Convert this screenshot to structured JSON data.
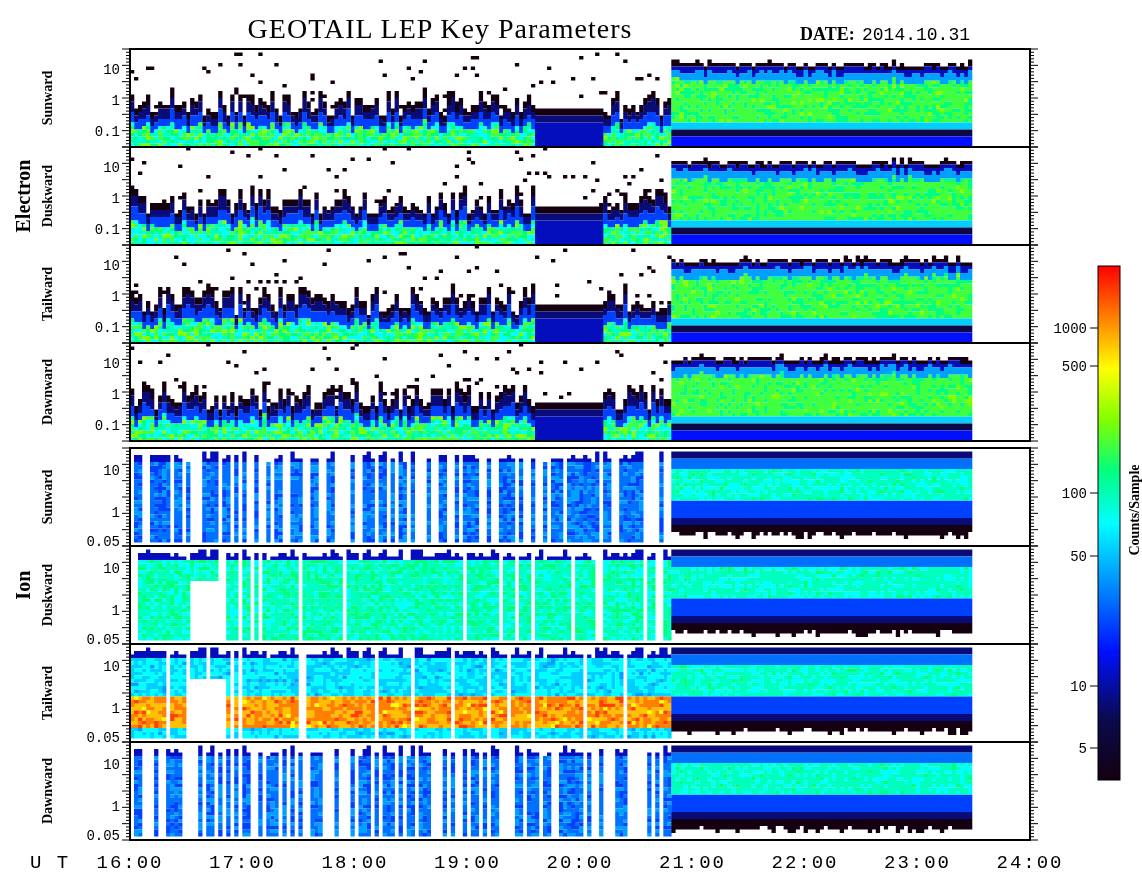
{
  "title": "GEOTAIL LEP Key Parameters",
  "date": {
    "label": "DATE:",
    "value": "2014.10.31"
  },
  "groups": [
    {
      "name": "Electron",
      "kind": "electron",
      "panels": [
        {
          "label": "Sunward",
          "yticks": [
            "10",
            "1",
            "0.1"
          ]
        },
        {
          "label": "Duskward",
          "yticks": [
            "10",
            "1",
            "0.1"
          ]
        },
        {
          "label": "Tailward",
          "yticks": [
            "10",
            "1",
            "0.1"
          ]
        },
        {
          "label": "Dawnward",
          "yticks": [
            "10",
            "1",
            "0.1"
          ]
        }
      ]
    },
    {
      "name": "Ion",
      "kind": "ion",
      "panels": [
        {
          "label": "Sunward",
          "yticks": [
            "10",
            "1",
            "0.05"
          ]
        },
        {
          "label": "Duskward",
          "yticks": [
            "10",
            "1",
            "0.05"
          ]
        },
        {
          "label": "Tailward",
          "yticks": [
            "10",
            "1",
            "0.05"
          ]
        },
        {
          "label": "Dawnward",
          "yticks": [
            "10",
            "1",
            "0.05"
          ]
        }
      ]
    }
  ],
  "x_axis": {
    "label": "U T",
    "ticks": [
      "16:00",
      "17:00",
      "18:00",
      "19:00",
      "20:00",
      "21:00",
      "22:00",
      "23:00",
      "24:00"
    ]
  },
  "colorbar": {
    "label": "Counts/Sample",
    "ticks": [
      "1000",
      "500",
      "100",
      "50",
      "10",
      "5"
    ]
  }
}
